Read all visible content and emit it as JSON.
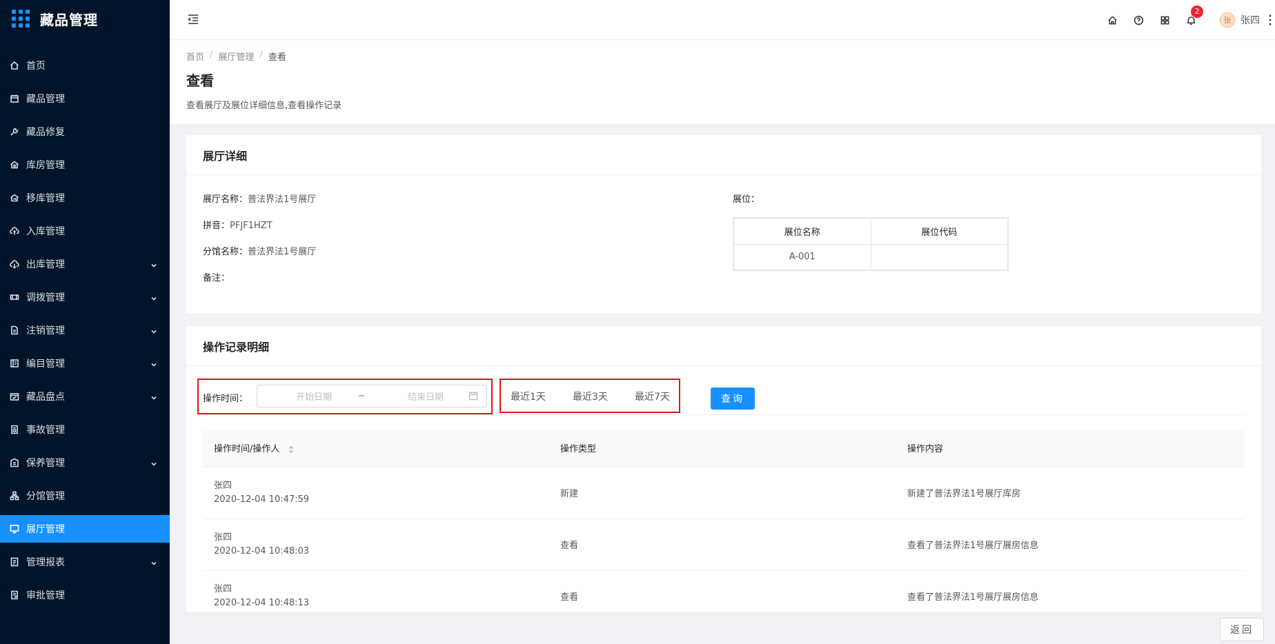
{
  "app": {
    "title": "藏品管理"
  },
  "sidebar": {
    "items": [
      {
        "label": "首页",
        "icon": "home-icon",
        "expandable": false,
        "active": false
      },
      {
        "label": "藏品管理",
        "icon": "calendar-icon",
        "expandable": false,
        "active": false
      },
      {
        "label": "藏品修复",
        "icon": "wrench-icon",
        "expandable": false,
        "active": false
      },
      {
        "label": "库房管理",
        "icon": "warehouse-icon",
        "expandable": false,
        "active": false
      },
      {
        "label": "移库管理",
        "icon": "transfer-icon",
        "expandable": false,
        "active": false
      },
      {
        "label": "入库管理",
        "icon": "cloud-upload-icon",
        "expandable": false,
        "active": false
      },
      {
        "label": "出库管理",
        "icon": "cloud-download-icon",
        "expandable": true,
        "active": false
      },
      {
        "label": "调拨管理",
        "icon": "swap-icon",
        "expandable": true,
        "active": false
      },
      {
        "label": "注销管理",
        "icon": "file-icon",
        "expandable": true,
        "active": false
      },
      {
        "label": "编目管理",
        "icon": "catalog-icon",
        "expandable": true,
        "active": false
      },
      {
        "label": "藏品盘点",
        "icon": "inventory-icon",
        "expandable": true,
        "active": false
      },
      {
        "label": "事故管理",
        "icon": "incident-icon",
        "expandable": false,
        "active": false
      },
      {
        "label": "保养管理",
        "icon": "maintenance-icon",
        "expandable": true,
        "active": false
      },
      {
        "label": "分馆管理",
        "icon": "branch-icon",
        "expandable": false,
        "active": false
      },
      {
        "label": "展厅管理",
        "icon": "monitor-icon",
        "expandable": false,
        "active": true
      },
      {
        "label": "管理报表",
        "icon": "report-icon",
        "expandable": true,
        "active": false
      },
      {
        "label": "审批管理",
        "icon": "approval-icon",
        "expandable": false,
        "active": false
      }
    ]
  },
  "header": {
    "notification_count": "2",
    "user_name": "张四",
    "avatar_text": "张"
  },
  "page": {
    "breadcrumb": [
      "首页",
      "展厅管理",
      "查看"
    ],
    "title": "查看",
    "description": "查看展厅及展位详细信息,查看操作记录"
  },
  "hall_detail": {
    "title": "展厅详细",
    "fields": [
      {
        "key": "展厅名称：",
        "value": "普法界法1号展厅"
      },
      {
        "key": "拼音：",
        "value": "PFJF1HZT"
      },
      {
        "key": "分馆名称：",
        "value": "普法界法1号展厅"
      },
      {
        "key": "备注：",
        "value": ""
      }
    ],
    "position_label": "展位：",
    "position_table": {
      "headers": [
        "展位名称",
        "展位代码"
      ],
      "rows": [
        [
          "A-001",
          ""
        ]
      ]
    }
  },
  "operation_log": {
    "title": "操作记录明细",
    "filter": {
      "label": "操作时间：",
      "start_placeholder": "开始日期",
      "separator": "~",
      "end_placeholder": "结束日期",
      "quick_ranges": [
        "最近1天",
        "最近3天",
        "最近7天"
      ],
      "query_label": "查询"
    },
    "table": {
      "headers": [
        "操作时间/操作人",
        "操作类型",
        "操作内容"
      ],
      "rows": [
        {
          "user": "张四",
          "time": "2020-12-04 10:47:59",
          "type": "新建",
          "content": "新建了普法界法1号展厅库房"
        },
        {
          "user": "张四",
          "time": "2020-12-04 10:48:03",
          "type": "查看",
          "content": "查看了普法界法1号展厅展房信息"
        },
        {
          "user": "张四",
          "time": "2020-12-04 10:48:13",
          "type": "查看",
          "content": "查看了普法界法1号展厅展房信息"
        }
      ]
    }
  },
  "footer": {
    "back_label": "返回"
  },
  "colors": {
    "sidebar_bg": "#001529",
    "accent": "#1890ff",
    "highlight_box": "#e81212",
    "badge": "#f5222d"
  }
}
